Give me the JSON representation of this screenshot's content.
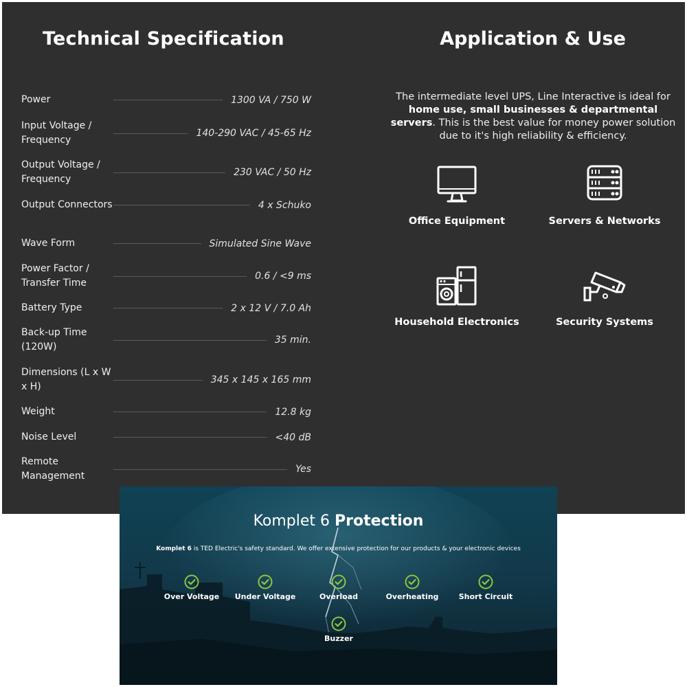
{
  "technical_specification": {
    "title": "Technical Specification",
    "rows": [
      {
        "label": "Power",
        "value": "1300 VA / 750 W"
      },
      {
        "label": "Input Voltage / Frequency",
        "value": "140-290 VAC / 45-65 Hz"
      },
      {
        "label": "Output Voltage / Frequency",
        "value": "230 VAC / 50 Hz"
      },
      {
        "label": "Output Connectors",
        "value": "4 x Schuko"
      },
      {
        "label": "Wave Form",
        "value": "Simulated Sine Wave"
      },
      {
        "label": "Power Factor / Transfer Time",
        "value": "0.6 / <9 ms"
      },
      {
        "label": "Battery Type",
        "value": "2 x 12 V / 7.0 Ah"
      },
      {
        "label": "Back-up Time (120W)",
        "value": "35 min."
      },
      {
        "label": "Dimensions (L x W x H)",
        "value": "345 x 145 x 165 mm"
      },
      {
        "label": "Weight",
        "value": "12.8 kg"
      },
      {
        "label": "Noise Level",
        "value": "<40 dB"
      },
      {
        "label": "Remote Management",
        "value": "Yes"
      }
    ]
  },
  "application_use": {
    "title": "Application & Use",
    "description_intro": "The intermediate level UPS, Line Interactive is ideal for ",
    "description_bold": "home use, small businesses & departmental servers",
    "description_outro": ". This is the best value for money power solution due to it's high reliability & efficiency.",
    "items": [
      {
        "label": "Office Equipment",
        "icon": "monitor-icon"
      },
      {
        "label": "Servers & Networks",
        "icon": "server-rack-icon"
      },
      {
        "label": "Household Electronics",
        "icon": "appliances-icon"
      },
      {
        "label": "Security Systems",
        "icon": "security-camera-icon"
      }
    ]
  },
  "protection": {
    "title_light": "Komplet 6 ",
    "title_bold": "Protection",
    "subtitle_bold": "Komplet 6",
    "subtitle_rest": " is TED Electric's safety standard. We offer extensive protection for our products & your electronic devices",
    "features": [
      {
        "label": "Over Voltage",
        "icon": "check-circle-icon"
      },
      {
        "label": "Under Voltage",
        "icon": "check-circle-icon"
      },
      {
        "label": "Overload",
        "icon": "check-circle-icon"
      },
      {
        "label": "Overheating",
        "icon": "check-circle-icon"
      },
      {
        "label": "Short Circuit",
        "icon": "check-circle-icon"
      },
      {
        "label": "Buzzer",
        "icon": "check-circle-icon"
      }
    ],
    "colors": {
      "check": "#8cc63f",
      "background": "#12394a"
    }
  }
}
